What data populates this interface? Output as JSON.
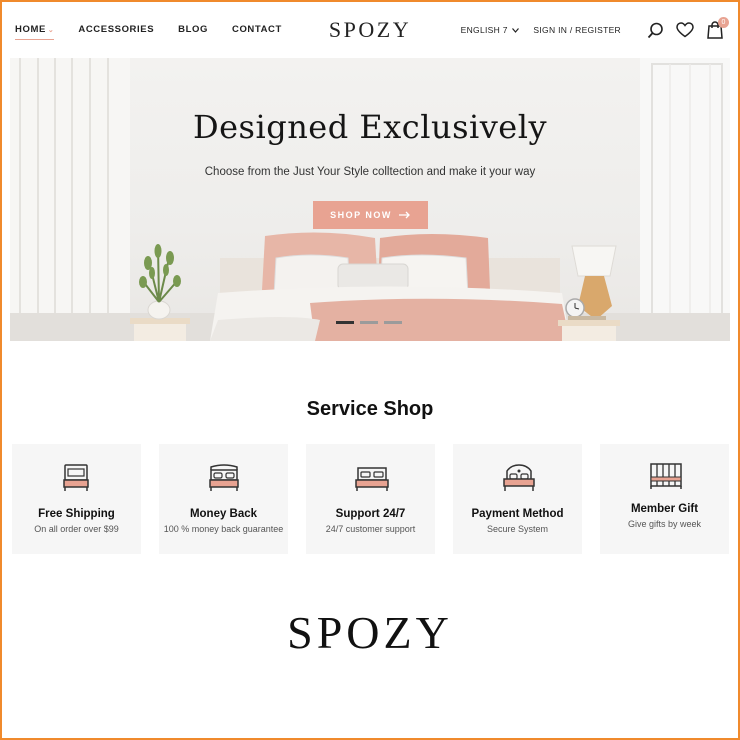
{
  "header": {
    "nav": [
      {
        "label": "HOME",
        "active": true
      },
      {
        "label": "ACCESSORIES"
      },
      {
        "label": "BLOG"
      },
      {
        "label": "CONTACT"
      }
    ],
    "logo": "SPOZY",
    "language": "ENGLISH 7",
    "signin": "SIGN IN / REGISTER",
    "cart_count": "0",
    "icons": [
      "search-icon",
      "heart-icon",
      "cart-icon"
    ]
  },
  "hero": {
    "title": "Designed Exclusively",
    "subtitle": "Choose from the Just Your Style colltection and make it your way",
    "button": "SHOP NOW",
    "slides": 3,
    "active_slide": 0
  },
  "services": {
    "title": "Service Shop",
    "items": [
      {
        "name": "Free Shipping",
        "desc": "On all order over $99",
        "icon": "single-bed-icon"
      },
      {
        "name": "Money Back",
        "desc": "100 % money back guarantee",
        "icon": "double-bed-icon"
      },
      {
        "name": "Support 24/7",
        "desc": "24/7 customer support",
        "icon": "bed-icon"
      },
      {
        "name": "Payment Method",
        "desc": "Secure System",
        "icon": "ornate-bed-icon"
      },
      {
        "name": "Member Gift",
        "desc": "Give gifts by week",
        "icon": "crib-icon"
      }
    ]
  },
  "footer": {
    "logo": "SPOZY"
  },
  "colors": {
    "accent": "#e8a392",
    "border": "#f08a2c",
    "card_bg": "#f6f6f6"
  }
}
